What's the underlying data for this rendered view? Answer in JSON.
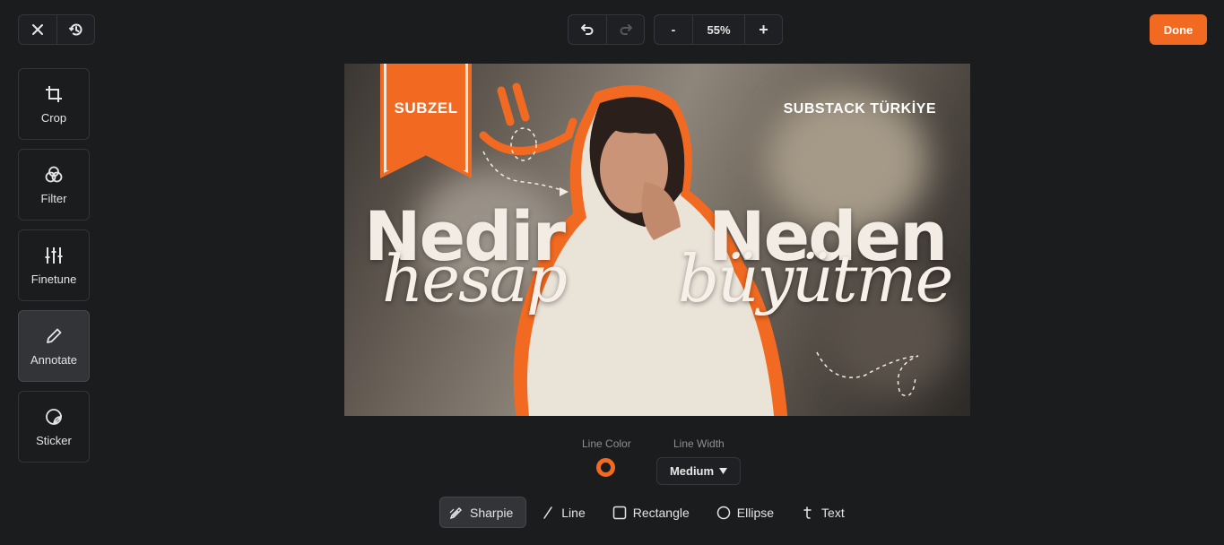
{
  "top_left": {
    "close_icon": "close-icon",
    "history_icon": "history-icon"
  },
  "history": {
    "undo_icon": "undo-icon",
    "redo_icon": "redo-icon"
  },
  "zoom": {
    "minus_label": "-",
    "value": "55%",
    "plus_label": "+"
  },
  "done_label": "Done",
  "sidebar": {
    "items": [
      {
        "label": "Crop",
        "icon": "crop-icon"
      },
      {
        "label": "Filter",
        "icon": "filter-icon"
      },
      {
        "label": "Finetune",
        "icon": "finetune-icon"
      },
      {
        "label": "Annotate",
        "icon": "pencil-icon",
        "active": true
      },
      {
        "label": "Sticker",
        "icon": "sticker-icon"
      }
    ]
  },
  "image": {
    "ribbon_text": "SUBZEL",
    "brand_text": "SUBSTACK TÜRKİYE",
    "word_left": "Nedir",
    "word_right": "Neden",
    "script_left": "hesap",
    "script_right": "büyütme",
    "accent_color": "#f26a21"
  },
  "properties": {
    "line_color_label": "Line Color",
    "line_color_value": "#f26a21",
    "line_width_label": "Line Width",
    "line_width_value": "Medium"
  },
  "shapes": [
    {
      "label": "Sharpie",
      "icon": "sharpie-icon",
      "active": true
    },
    {
      "label": "Line",
      "icon": "line-icon"
    },
    {
      "label": "Rectangle",
      "icon": "rectangle-icon"
    },
    {
      "label": "Ellipse",
      "icon": "ellipse-icon"
    },
    {
      "label": "Text",
      "icon": "text-icon"
    }
  ]
}
